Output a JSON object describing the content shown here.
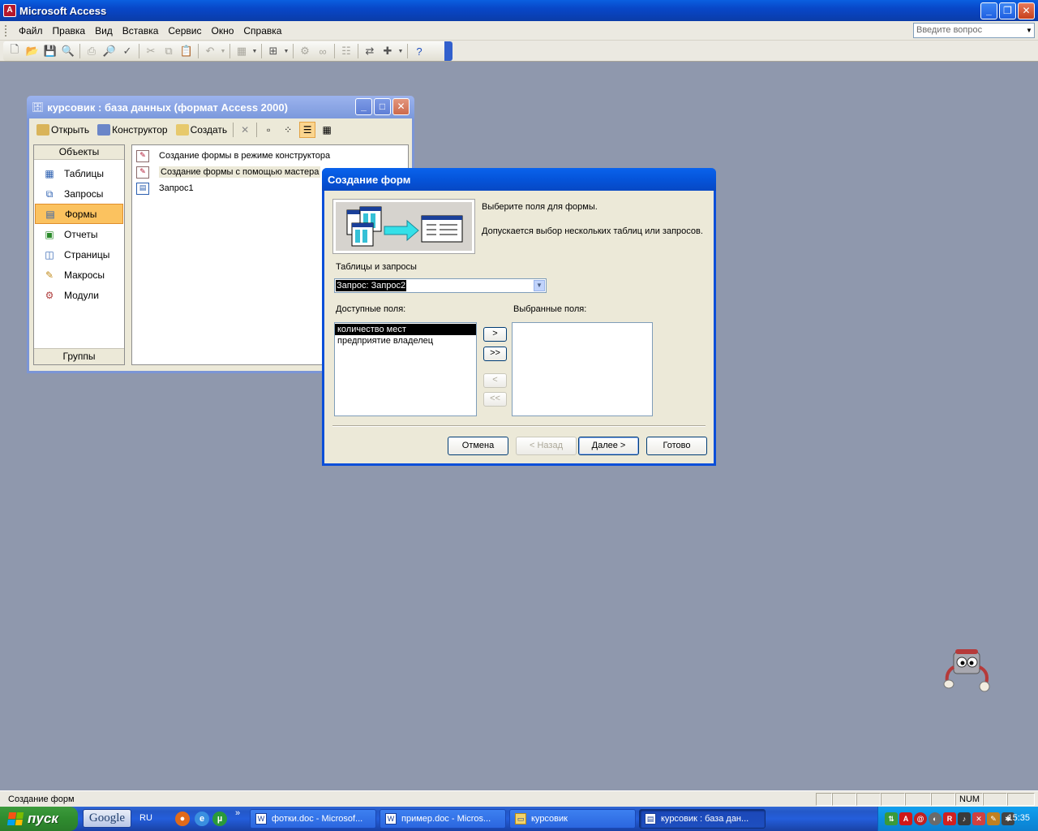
{
  "app": {
    "title": "Microsoft Access",
    "menu": [
      "Файл",
      "Правка",
      "Вид",
      "Вставка",
      "Сервис",
      "Окно",
      "Справка"
    ],
    "help_placeholder": "Введите вопрос"
  },
  "db_window": {
    "title": "курсовик : база данных (формат Access 2000)",
    "toolbar": {
      "open": "Открыть",
      "design": "Конструктор",
      "create": "Создать"
    },
    "objects_header": "Объекты",
    "groups_footer": "Группы",
    "objects": [
      {
        "label": "Таблицы",
        "icon": "table-icon"
      },
      {
        "label": "Запросы",
        "icon": "query-icon"
      },
      {
        "label": "Формы",
        "icon": "form-icon",
        "selected": true
      },
      {
        "label": "Отчеты",
        "icon": "report-icon"
      },
      {
        "label": "Страницы",
        "icon": "page-icon"
      },
      {
        "label": "Макросы",
        "icon": "macro-icon"
      },
      {
        "label": "Модули",
        "icon": "module-icon"
      }
    ],
    "items": [
      "Создание формы в режиме конструктора",
      "Создание формы с помощью мастера",
      "Запрос1"
    ]
  },
  "wizard": {
    "title": "Создание форм",
    "prompt1": "Выберите поля для формы.",
    "prompt2": "Допускается выбор нескольких таблиц или запросов.",
    "tables_label": "Таблицы и запросы",
    "source_value": "Запрос: Запрос2",
    "available_label": "Доступные поля:",
    "selected_label": "Выбранные поля:",
    "available_fields": [
      "количество мест",
      "предприятие владелец"
    ],
    "selected_fields": [],
    "move_buttons": {
      "add": ">",
      "add_all": ">>",
      "remove": "<",
      "remove_all": "<<"
    },
    "buttons": {
      "cancel": "Отмена",
      "back": "< Назад",
      "next": "Далее >",
      "finish": "Готово"
    }
  },
  "statusbar": {
    "text": "Создание форм",
    "num": "NUM"
  },
  "taskbar": {
    "start": "пуск",
    "google": "Google",
    "lang": "RU",
    "tasks": [
      "фотки.doc - Microsof...",
      "пример.doc - Micros...",
      "курсовик",
      "курсовик : база дан..."
    ],
    "clock": "15:35"
  }
}
